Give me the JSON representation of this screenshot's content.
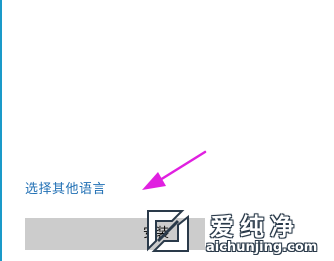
{
  "links": {
    "other_languages": "选择其他语言"
  },
  "buttons": {
    "install": "安装"
  },
  "annotation": {
    "arrow_color": "#e020e0",
    "icon": "pointer-arrow-icon"
  },
  "watermark": {
    "title": "爱纯净",
    "url": "aichunjing.com",
    "icon": "aichunjing-logo-icon"
  },
  "colors": {
    "link": "#1f6fb4",
    "button_bg": "#cccccc",
    "accent_border": "#1a9ac9"
  }
}
